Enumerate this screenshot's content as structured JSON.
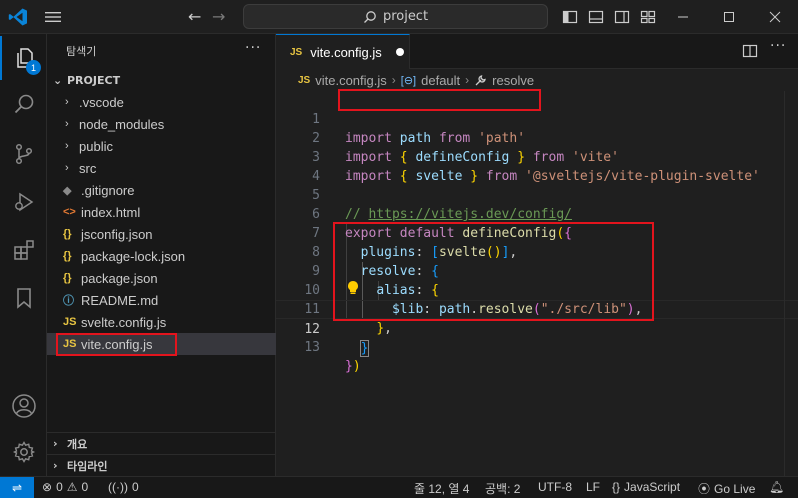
{
  "titlebar": {
    "search_text": "project",
    "colors": {
      "logo": "#0a84d8"
    }
  },
  "activitybar": {
    "explorer_badge": "1",
    "items": [
      "explorer-icon",
      "search-icon",
      "source-control-icon",
      "run-debug-icon",
      "extensions-icon",
      "bookmark-icon",
      "account-icon",
      "settings-icon"
    ]
  },
  "sidebar": {
    "header": "탐색기",
    "more": "···",
    "project": "PROJECT",
    "tree": [
      {
        "label": ".vscode",
        "type": "folder",
        "icon": "chevron-right-icon"
      },
      {
        "label": "node_modules",
        "type": "folder",
        "icon": "chevron-right-icon"
      },
      {
        "label": "public",
        "type": "folder",
        "icon": "chevron-right-icon"
      },
      {
        "label": "src",
        "type": "folder",
        "icon": "chevron-right-icon"
      },
      {
        "label": ".gitignore",
        "type": "file",
        "icon": "git-icon"
      },
      {
        "label": "index.html",
        "type": "file",
        "icon": "html-icon"
      },
      {
        "label": "jsconfig.json",
        "type": "file",
        "icon": "json-icon"
      },
      {
        "label": "package-lock.json",
        "type": "file",
        "icon": "json-icon"
      },
      {
        "label": "package.json",
        "type": "file",
        "icon": "json-icon"
      },
      {
        "label": "README.md",
        "type": "file",
        "icon": "info-icon"
      },
      {
        "label": "svelte.config.js",
        "type": "file",
        "icon": "js-icon"
      },
      {
        "label": "vite.config.js",
        "type": "file",
        "icon": "js-icon",
        "selected": true
      }
    ],
    "sections": [
      "개요",
      "타임라인"
    ]
  },
  "editor": {
    "tab": {
      "label": "vite.config.js",
      "badge": "JS",
      "modified": true
    },
    "breadcrumb": {
      "file": "vite.config.js",
      "symbol1": "default",
      "symbol2": "resolve"
    },
    "lines": [
      {
        "n": "1",
        "text": "import path from 'path'"
      },
      {
        "n": "2",
        "text": "import { defineConfig } from 'vite'"
      },
      {
        "n": "3",
        "text": "import { svelte } from '@sveltejs/vite-plugin-svelte'"
      },
      {
        "n": "4",
        "text": ""
      },
      {
        "n": "5",
        "text": "// https://vitejs.dev/config/"
      },
      {
        "n": "6",
        "text": "export default defineConfig({"
      },
      {
        "n": "7",
        "text": "  plugins: [svelte()],"
      },
      {
        "n": "8",
        "text": "  resolve: {"
      },
      {
        "n": "9",
        "text": "    alias: {"
      },
      {
        "n": "10",
        "text": "      $lib: path.resolve(\"./src/lib\"),"
      },
      {
        "n": "11",
        "text": "    },"
      },
      {
        "n": "12",
        "text": "  }"
      },
      {
        "n": "13",
        "text": "})"
      }
    ],
    "current_line": "12"
  },
  "statusbar": {
    "errors": "0",
    "warnings": "0",
    "ports": "0",
    "position": "줄 12, 열 4",
    "indent": "공백: 2",
    "encoding": "UTF-8",
    "eol": "LF",
    "language": "JavaScript",
    "golive": "Go Live"
  },
  "highlights": {
    "color": "#e3141d"
  }
}
